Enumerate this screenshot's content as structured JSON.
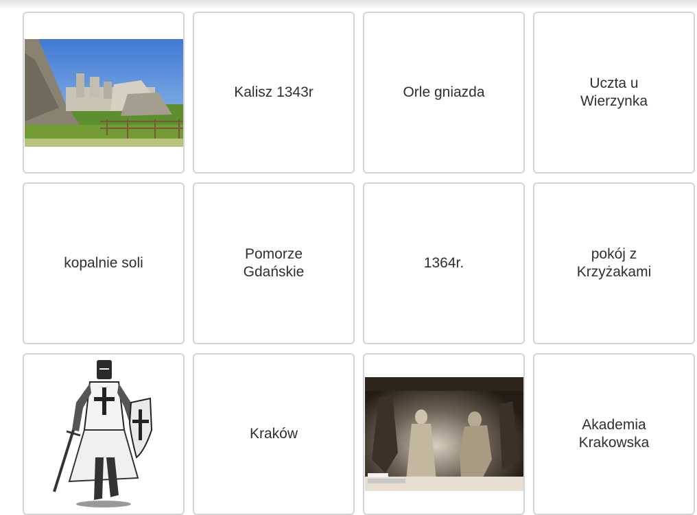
{
  "cards": [
    {
      "type": "image",
      "image": "castle-ruins-photo"
    },
    {
      "type": "text",
      "label": "Kalisz 1343r"
    },
    {
      "type": "text",
      "label": "Orle gniazda"
    },
    {
      "type": "text",
      "label": "Uczta u Wierzynka"
    },
    {
      "type": "text",
      "label": "kopalnie soli"
    },
    {
      "type": "text",
      "label": "Pomorze Gdańskie"
    },
    {
      "type": "text",
      "label": "1364r."
    },
    {
      "type": "text",
      "label": "pokój z Krzyżakami"
    },
    {
      "type": "image",
      "image": "teutonic-knight-drawing"
    },
    {
      "type": "text",
      "label": "Kraków"
    },
    {
      "type": "image",
      "image": "salt-mine-sculpture-photo"
    },
    {
      "type": "text",
      "label": "Akademia Krakowska"
    }
  ]
}
